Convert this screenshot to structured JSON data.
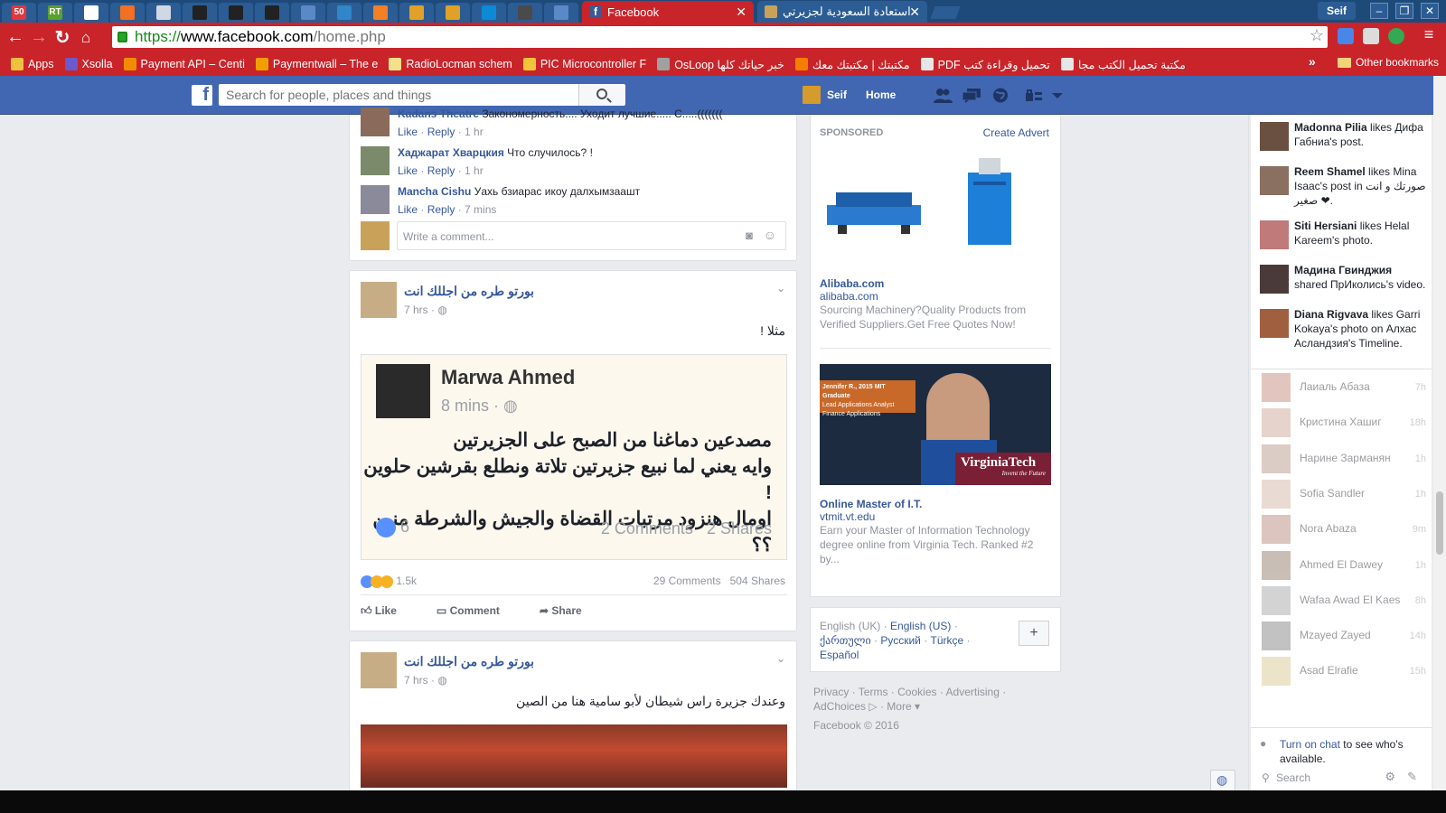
{
  "browser": {
    "pinned_tabs": [
      {
        "icon": "badge-50-icon",
        "text": "50",
        "color": "#e0383e"
      },
      {
        "icon": "rt-icon",
        "text": "RT",
        "color": "#5aa02c"
      },
      {
        "icon": "russia-flag-icon",
        "text": "",
        "color": "#ffffff"
      },
      {
        "icon": "soundcloud-icon",
        "text": "",
        "color": "#f26f23"
      },
      {
        "icon": "moon-icon",
        "text": "",
        "color": "#cfd8e3"
      },
      {
        "icon": "github-icon",
        "text": "",
        "color": "#222222"
      },
      {
        "icon": "github-icon",
        "text": "",
        "color": "#222222"
      },
      {
        "icon": "github-icon",
        "text": "",
        "color": "#222222"
      },
      {
        "icon": "doc-icon",
        "text": "",
        "color": "#5b88c6"
      },
      {
        "icon": "site-icon",
        "text": "",
        "color": "#2f86c8"
      },
      {
        "icon": "stackoverflow-icon",
        "text": "",
        "color": "#f48024"
      },
      {
        "icon": "app-icon",
        "text": "",
        "color": "#e0a126"
      },
      {
        "icon": "app-icon",
        "text": "",
        "color": "#e0a126"
      },
      {
        "icon": "windows-icon",
        "text": "",
        "color": "#0c8ad6"
      },
      {
        "icon": "site-icon",
        "text": "",
        "color": "#4a4a4a"
      },
      {
        "icon": "doc-icon",
        "text": "",
        "color": "#5b88c6"
      }
    ],
    "tabs": [
      {
        "title": "Facebook",
        "active": true
      },
      {
        "title": "استعادة السعودية لجزيرتي",
        "active": false
      }
    ],
    "window_user": "Seif",
    "url": {
      "scheme": "https://",
      "host": "www.facebook.com",
      "path": "/home.php"
    },
    "bookmarks": [
      {
        "label": "Apps",
        "color": "#f0c040"
      },
      {
        "label": "Xsolla",
        "color": "#6a5acd"
      },
      {
        "label": "Payment API – Centi",
        "color": "#f28c00"
      },
      {
        "label": "Paymentwall – The e",
        "color": "#f0a000"
      },
      {
        "label": "RadioLocman schem",
        "color": "#f2e08a"
      },
      {
        "label": "PIC Microcontroller F",
        "color": "#f2c43a"
      },
      {
        "label": "OsLoop خبر حياتك كلها",
        "color": "#a0a0a0"
      },
      {
        "label": "مكتبتك | مكتبتك معك",
        "color": "#f57d00"
      },
      {
        "label": "PDF تحميل وقراءة كتب",
        "color": "#e6e6e6"
      },
      {
        "label": "مكتبة تحميل الكتب مجا",
        "color": "#e6e6e6"
      }
    ],
    "bookmarks_more": "»",
    "other_bookmarks": "Other bookmarks"
  },
  "fb": {
    "search_placeholder": "Search for people, places and things",
    "user": "Seif",
    "home": "Home"
  },
  "comments": [
    {
      "name": "Kadans Theatre",
      "text": "Закономерность.... Уходит лучшие..... С.....(((((((",
      "time": "1 hr"
    },
    {
      "name": "Хаджарат Хварцкия",
      "text": "Что случилось? !",
      "time": "1 hr"
    },
    {
      "name": "Mancha Cishu",
      "text": "Уахь бзиарас икоу далхымзаашт",
      "time": "7 mins"
    }
  ],
  "comment_actions": {
    "like": "Like",
    "reply": "Reply"
  },
  "comment_placeholder": "Write a comment...",
  "posts": [
    {
      "author": "بورتو طره من اجللك انت",
      "time": "7 hrs",
      "text": "مثلا !",
      "shared": {
        "name": "Marwa Ahmed",
        "time": "8 mins",
        "lines": [
          "مصدعين دماغنا من الصبح على الجزيرتين",
          "وايه يعني لما نبيع جزيرتين تلاتة ونطلع بقرشين حلوين !",
          "اومال هنزود مرتبات القضاة والجيش والشرطة منين ؟؟"
        ],
        "likes": "6",
        "comments": "2 Comments",
        "shares": "2 Shares"
      },
      "reactions": "1.5k",
      "comments": "29 Comments",
      "shares": "504 Shares"
    },
    {
      "author": "بورتو طره من اجللك انت",
      "time": "7 hrs",
      "text": "وعندك جزيرة راس شيطان لأبو سامية هنا من الصين"
    }
  ],
  "post_actions": {
    "like": "Like",
    "comment": "Comment",
    "share": "Share"
  },
  "ads": {
    "label": "SPONSORED",
    "create": "Create Advert",
    "items": [
      {
        "title": "Alibaba.com",
        "url": "alibaba.com",
        "text": "Sourcing Machinery?Quality Products from Verified Suppliers.Get Free Quotes Now!"
      },
      {
        "title": "Online Master of I.T.",
        "url": "vtmit.vt.edu",
        "text": "Earn your Master of Information Technology degree online from Virginia Tech. Ranked #2 by..."
      }
    ],
    "banner": {
      "caption1": "Jennifer R., 2015 MIT Graduate",
      "caption2": "Lead Applications Analyst",
      "caption3": "Finance Applications",
      "brand": "VirginiaTech",
      "tagline": "Invent the Future"
    }
  },
  "languages": {
    "current": "English (UK)",
    "others": [
      "English (US)",
      "ქართული",
      "Русский",
      "Türkçe",
      "Español"
    ],
    "more_button": "+"
  },
  "footer": {
    "links": [
      "Privacy",
      "Terms",
      "Cookies",
      "Advertising",
      "AdChoices",
      "More"
    ],
    "copyright": "Facebook © 2016"
  },
  "ticker": [
    {
      "name": "Madonna Pilia",
      "text": " likes Дифа Габниа's post."
    },
    {
      "name": "Reem Shamel",
      "text": " likes Mina Isaac's post in صورتك و انت صغير ❤."
    },
    {
      "name": "Siti Hersiani",
      "text": " likes Helal Kareem's photo."
    },
    {
      "name": "Мадина Гвинджия",
      "text": " shared ПрИколись's video."
    },
    {
      "name": "Diana Rigvava",
      "text": " likes Garri Kokaya's photo on Алхас Асландзия's Timeline."
    }
  ],
  "chat_friends": [
    {
      "name": "Лаиаль Абаза",
      "time": "7h"
    },
    {
      "name": "Кристина Хашиг",
      "time": "18h"
    },
    {
      "name": "Нарине Зарманян",
      "time": "1h"
    },
    {
      "name": "Sofia Sandler",
      "time": "1h"
    },
    {
      "name": "Nora Abaza",
      "time": "9m"
    },
    {
      "name": "Ahmed El Dawey",
      "time": "1h"
    },
    {
      "name": "Wafaa Awad El Kaes",
      "time": "8h"
    },
    {
      "name": "Mzayed Zayed",
      "time": "14h"
    },
    {
      "name": "Asad Elrafie",
      "time": "15h"
    }
  ],
  "chat": {
    "turn_on": "Turn on chat",
    "rest": " to see who's available.",
    "search": "Search"
  }
}
